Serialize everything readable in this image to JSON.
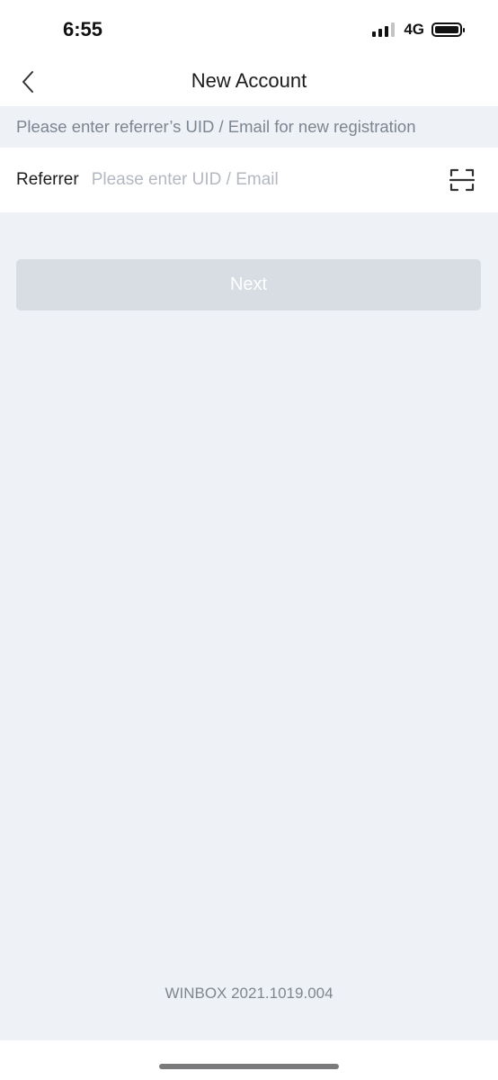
{
  "status_bar": {
    "time": "6:55",
    "network": "4G",
    "signal_bars_active": 3,
    "signal_bars_total": 4,
    "battery_level": 1.0
  },
  "nav": {
    "title": "New Account",
    "back_icon": "chevron-left-icon"
  },
  "hint": {
    "text": "Please enter referrer’s UID / Email for new registration"
  },
  "referrer": {
    "label": "Referrer",
    "value": "",
    "placeholder": "Please enter UID / Email",
    "scan_icon": "scan-frame-icon"
  },
  "next_button": {
    "label": "Next",
    "enabled": false
  },
  "footer": {
    "version": "WINBOX 2021.1019.004"
  },
  "colors": {
    "background": "#eef1f5",
    "surface": "#ffffff",
    "hint_text": "#7d8593",
    "placeholder_text": "#b3b8c1",
    "button_disabled": "#d8dce3",
    "version_text": "#80868f"
  }
}
